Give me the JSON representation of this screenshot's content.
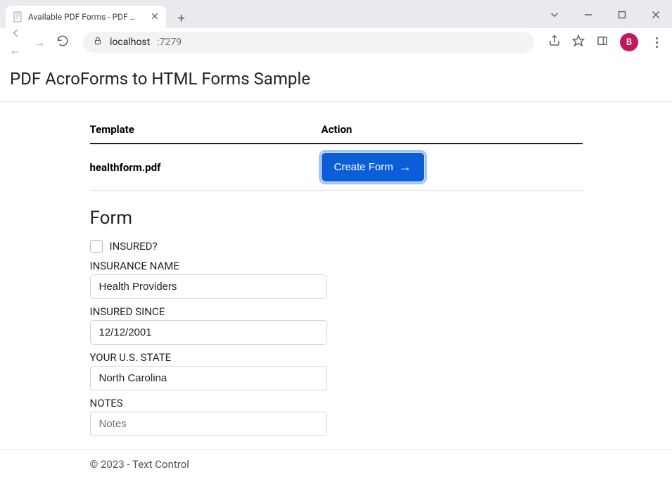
{
  "browser": {
    "tab_title": "Available PDF Forms - PDF AcroF",
    "url_host": "localhost",
    "url_port": ":7279",
    "avatar_letter": "B"
  },
  "page": {
    "title": "PDF AcroForms to HTML Forms Sample"
  },
  "table": {
    "col_template": "Template",
    "col_action": "Action",
    "filename": "healthform.pdf",
    "create_button": "Create Form"
  },
  "form": {
    "heading": "Form",
    "insured_label": "INSURED?",
    "insurance_name_label": "INSURANCE NAME",
    "insurance_name_value": "Health Providers",
    "insured_since_label": "INSURED SINCE",
    "insured_since_value": "12/12/2001",
    "state_label": "YOUR U.S. STATE",
    "state_value": "North Carolina",
    "notes_label": "NOTES",
    "notes_placeholder": "Notes"
  },
  "footer": {
    "text": "© 2023 - Text Control"
  }
}
